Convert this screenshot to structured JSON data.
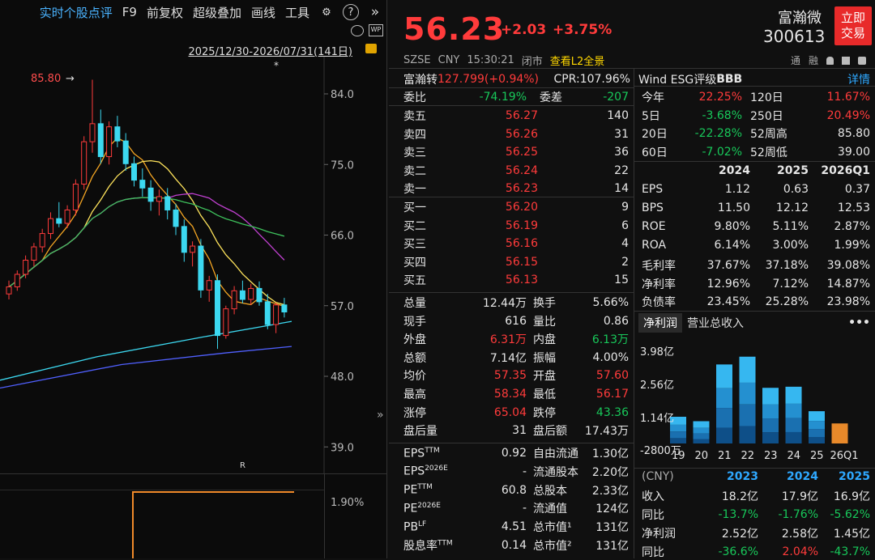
{
  "toolbar": {
    "items": [
      "实时个股点评",
      "F9",
      "前复权",
      "超级叠加",
      "画线",
      "工具"
    ],
    "icons": [
      "gear-icon",
      "help-icon",
      "chevrons-right-icon"
    ],
    "sub_icons": [
      "live-icon",
      "wp-icon"
    ],
    "range": "2025/12/30-2026/07/31(141日)"
  },
  "chart": {
    "high_marker": "85.80",
    "star": "*",
    "r_marker": "R",
    "y_ticks": [
      "84.0",
      "75.0",
      "66.0",
      "57.0",
      "48.0",
      "39.0"
    ],
    "sub_tick": "1.90%",
    "expand": "»"
  },
  "chart_data": {
    "type": "candlestick",
    "y_ticks": [
      84.0,
      75.0,
      66.0,
      57.0,
      48.0,
      39.0
    ],
    "ylim": [
      35.0,
      90.0
    ],
    "ohlc": [
      [
        58.5,
        60.2,
        57.8,
        59.4
      ],
      [
        59.4,
        61.5,
        58.9,
        61.0
      ],
      [
        61.0,
        63.4,
        60.5,
        62.8
      ],
      [
        62.8,
        65.0,
        62.0,
        64.5
      ],
      [
        64.5,
        66.8,
        63.8,
        66.2
      ],
      [
        66.2,
        68.9,
        65.5,
        68.1
      ],
      [
        68.1,
        70.2,
        67.0,
        67.5
      ],
      [
        67.5,
        69.8,
        66.9,
        69.2
      ],
      [
        69.2,
        73.1,
        68.5,
        72.5
      ],
      [
        72.5,
        78.6,
        71.8,
        77.9
      ],
      [
        77.9,
        85.8,
        76.5,
        80.2
      ],
      [
        80.2,
        82.0,
        75.1,
        76.0
      ],
      [
        76.0,
        80.5,
        75.0,
        79.8
      ],
      [
        79.8,
        81.2,
        77.2,
        78.0
      ],
      [
        78.0,
        79.0,
        74.2,
        75.1
      ],
      [
        75.1,
        76.0,
        72.2,
        73.0
      ],
      [
        73.0,
        74.5,
        70.9,
        72.0
      ],
      [
        72.0,
        73.0,
        69.1,
        70.3
      ],
      [
        70.3,
        71.8,
        68.5,
        70.9
      ],
      [
        70.9,
        72.0,
        68.0,
        69.2
      ],
      [
        69.2,
        70.0,
        66.0,
        67.1
      ],
      [
        67.1,
        68.0,
        62.6,
        63.8
      ],
      [
        63.8,
        65.2,
        62.0,
        64.6
      ],
      [
        64.6,
        65.5,
        58.0,
        59.0
      ],
      [
        59.0,
        60.8,
        57.5,
        60.2
      ],
      [
        60.2,
        61.0,
        51.5,
        53.2
      ],
      [
        53.2,
        57.0,
        52.8,
        56.6
      ],
      [
        56.6,
        59.5,
        55.9,
        58.9
      ],
      [
        58.9,
        60.2,
        57.3,
        57.8
      ],
      [
        57.8,
        59.8,
        57.1,
        59.2
      ],
      [
        59.2,
        60.1,
        57.0,
        57.5
      ],
      [
        57.5,
        58.5,
        54.0,
        54.6
      ],
      [
        54.6,
        57.4,
        53.5,
        57.1
      ],
      [
        57.1,
        58.0,
        55.5,
        56.2
      ]
    ]
  },
  "header": {
    "price": "56.23",
    "change": "+2.03",
    "change_pct": "+3.75%",
    "name": "富瀚微",
    "code": "300613",
    "buy_line1": "立即",
    "buy_line2": "交易",
    "market": "SZSE",
    "currency": "CNY",
    "time": "15:30:21",
    "status": "闭市",
    "l2_link": "查看L2全景",
    "tool_labels": [
      "通",
      "融"
    ]
  },
  "conv": {
    "label": "富瀚转",
    "value": "127.799(+0.94%)",
    "cpr": "CPR:107.96%"
  },
  "weibi": {
    "label": "委比",
    "value": "-74.19%",
    "label2": "委差",
    "value2": "-207"
  },
  "sell_book": [
    {
      "label": "卖五",
      "price": "56.27",
      "vol": "140"
    },
    {
      "label": "卖四",
      "price": "56.26",
      "vol": "31"
    },
    {
      "label": "卖三",
      "price": "56.25",
      "vol": "36"
    },
    {
      "label": "卖二",
      "price": "56.24",
      "vol": "22"
    },
    {
      "label": "卖一",
      "price": "56.23",
      "vol": "14"
    }
  ],
  "buy_book": [
    {
      "label": "买一",
      "price": "56.20",
      "vol": "9"
    },
    {
      "label": "买二",
      "price": "56.19",
      "vol": "6"
    },
    {
      "label": "买三",
      "price": "56.16",
      "vol": "4"
    },
    {
      "label": "买四",
      "price": "56.15",
      "vol": "2"
    },
    {
      "label": "买五",
      "price": "56.13",
      "vol": "15"
    }
  ],
  "stats": [
    {
      "l1": "总量",
      "v1": "12.44万",
      "c1": "wht",
      "l2": "换手",
      "v2": "5.66%",
      "c2": "wht"
    },
    {
      "l1": "现手",
      "v1": "616",
      "c1": "wht",
      "l2": "量比",
      "v2": "0.86",
      "c2": "wht"
    },
    {
      "l1": "外盘",
      "v1": "6.31万",
      "c1": "red",
      "l2": "内盘",
      "v2": "6.13万",
      "c2": "grn"
    },
    {
      "l1": "总额",
      "v1": "7.14亿",
      "c1": "wht",
      "l2": "振幅",
      "v2": "4.00%",
      "c2": "wht"
    },
    {
      "l1": "均价",
      "v1": "57.35",
      "c1": "red",
      "l2": "开盘",
      "v2": "57.60",
      "c2": "red"
    },
    {
      "l1": "最高",
      "v1": "58.34",
      "c1": "red",
      "l2": "最低",
      "v2": "56.17",
      "c2": "red"
    },
    {
      "l1": "涨停",
      "v1": "65.04",
      "c1": "red",
      "l2": "跌停",
      "v2": "43.36",
      "c2": "grn"
    },
    {
      "l1": "盘后量",
      "v1": "31",
      "c1": "wht",
      "l2": "盘后额",
      "v2": "17.43万",
      "c2": "wht"
    }
  ],
  "valuation": [
    {
      "l1": "EPS",
      "s1": "TTM",
      "v1": "0.92",
      "l2": "自由流通",
      "v2": "1.30亿"
    },
    {
      "l1": "EPS",
      "s1": "2026E",
      "v1": "-",
      "l2": "流通股本",
      "v2": "2.20亿"
    },
    {
      "l1": "PE",
      "s1": "TTM",
      "v1": "60.8",
      "l2": "总股本",
      "v2": "2.33亿"
    },
    {
      "l1": "PE",
      "s1": "2026E",
      "v1": "-",
      "l2": "流通值",
      "v2": "124亿"
    },
    {
      "l1": "PB",
      "s1": "LF",
      "v1": "4.51",
      "l2": "总市值¹",
      "v2": "131亿"
    },
    {
      "l1": "股息率",
      "s1": "TTM",
      "v1": "0.14",
      "l2": "总市值²",
      "v2": "131亿"
    }
  ],
  "esg": {
    "prefix": "Wind ESG评级",
    "rating": "BBB",
    "detail": "详情"
  },
  "perf": [
    {
      "l1": "今年",
      "v1": "22.25%",
      "c1": "red",
      "l2": "120日",
      "v2": "11.67%",
      "c2": "red"
    },
    {
      "l1": "5日",
      "v1": "-3.68%",
      "c1": "grn",
      "l2": "250日",
      "v2": "20.49%",
      "c2": "red"
    },
    {
      "l1": "20日",
      "v1": "-22.28%",
      "c1": "grn",
      "l2": "52周高",
      "v2": "85.80",
      "c2": "wht"
    },
    {
      "l1": "60日",
      "v1": "-7.02%",
      "c1": "grn",
      "l2": "52周低",
      "v2": "39.00",
      "c2": "wht"
    }
  ],
  "fin": {
    "years": [
      "2024",
      "2025",
      "2026Q1"
    ],
    "rows": [
      {
        "label": "EPS",
        "vals": [
          "1.12",
          "0.63",
          "0.37"
        ]
      },
      {
        "label": "BPS",
        "vals": [
          "11.50",
          "12.12",
          "12.53"
        ]
      },
      {
        "label": "ROE",
        "vals": [
          "9.80%",
          "5.11%",
          "2.87%"
        ]
      },
      {
        "label": "ROA",
        "vals": [
          "6.14%",
          "3.00%",
          "1.99%"
        ]
      },
      {
        "label": "毛利率",
        "vals": [
          "37.67%",
          "37.18%",
          "39.08%"
        ]
      },
      {
        "label": "净利率",
        "vals": [
          "12.96%",
          "7.12%",
          "14.87%"
        ]
      },
      {
        "label": "负债率",
        "vals": [
          "23.45%",
          "25.28%",
          "23.98%"
        ]
      }
    ]
  },
  "profit_tabs": [
    "净利润",
    "营业总收入"
  ],
  "more": "•••",
  "profit_chart": {
    "y_labels": [
      "3.98亿",
      "2.56亿",
      "1.14亿",
      "-2800万"
    ],
    "x_labels": [
      "19",
      "20",
      "21",
      "22",
      "23",
      "24",
      "25",
      "26Q1"
    ],
    "values_yi": [
      1.2,
      1.0,
      3.55,
      3.9,
      2.5,
      2.55,
      1.45,
      0.9
    ],
    "highlight_last": true
  },
  "annual": {
    "unit": "(CNY)",
    "years": [
      "2023",
      "2024",
      "2025"
    ],
    "rows": [
      {
        "label": "收入",
        "vals": [
          "18.2亿",
          "17.9亿",
          "16.9亿"
        ],
        "colors": [
          "wht",
          "wht",
          "wht"
        ]
      },
      {
        "label": "同比",
        "vals": [
          "-13.7%",
          "-1.76%",
          "-5.62%"
        ],
        "colors": [
          "grn",
          "grn",
          "grn"
        ]
      },
      {
        "label": "净利润",
        "vals": [
          "2.52亿",
          "2.58亿",
          "1.45亿"
        ],
        "colors": [
          "wht",
          "wht",
          "wht"
        ]
      },
      {
        "label": "同比",
        "vals": [
          "-36.6%",
          "2.04%",
          "-43.7%"
        ],
        "colors": [
          "grn",
          "red",
          "grn"
        ]
      }
    ]
  }
}
